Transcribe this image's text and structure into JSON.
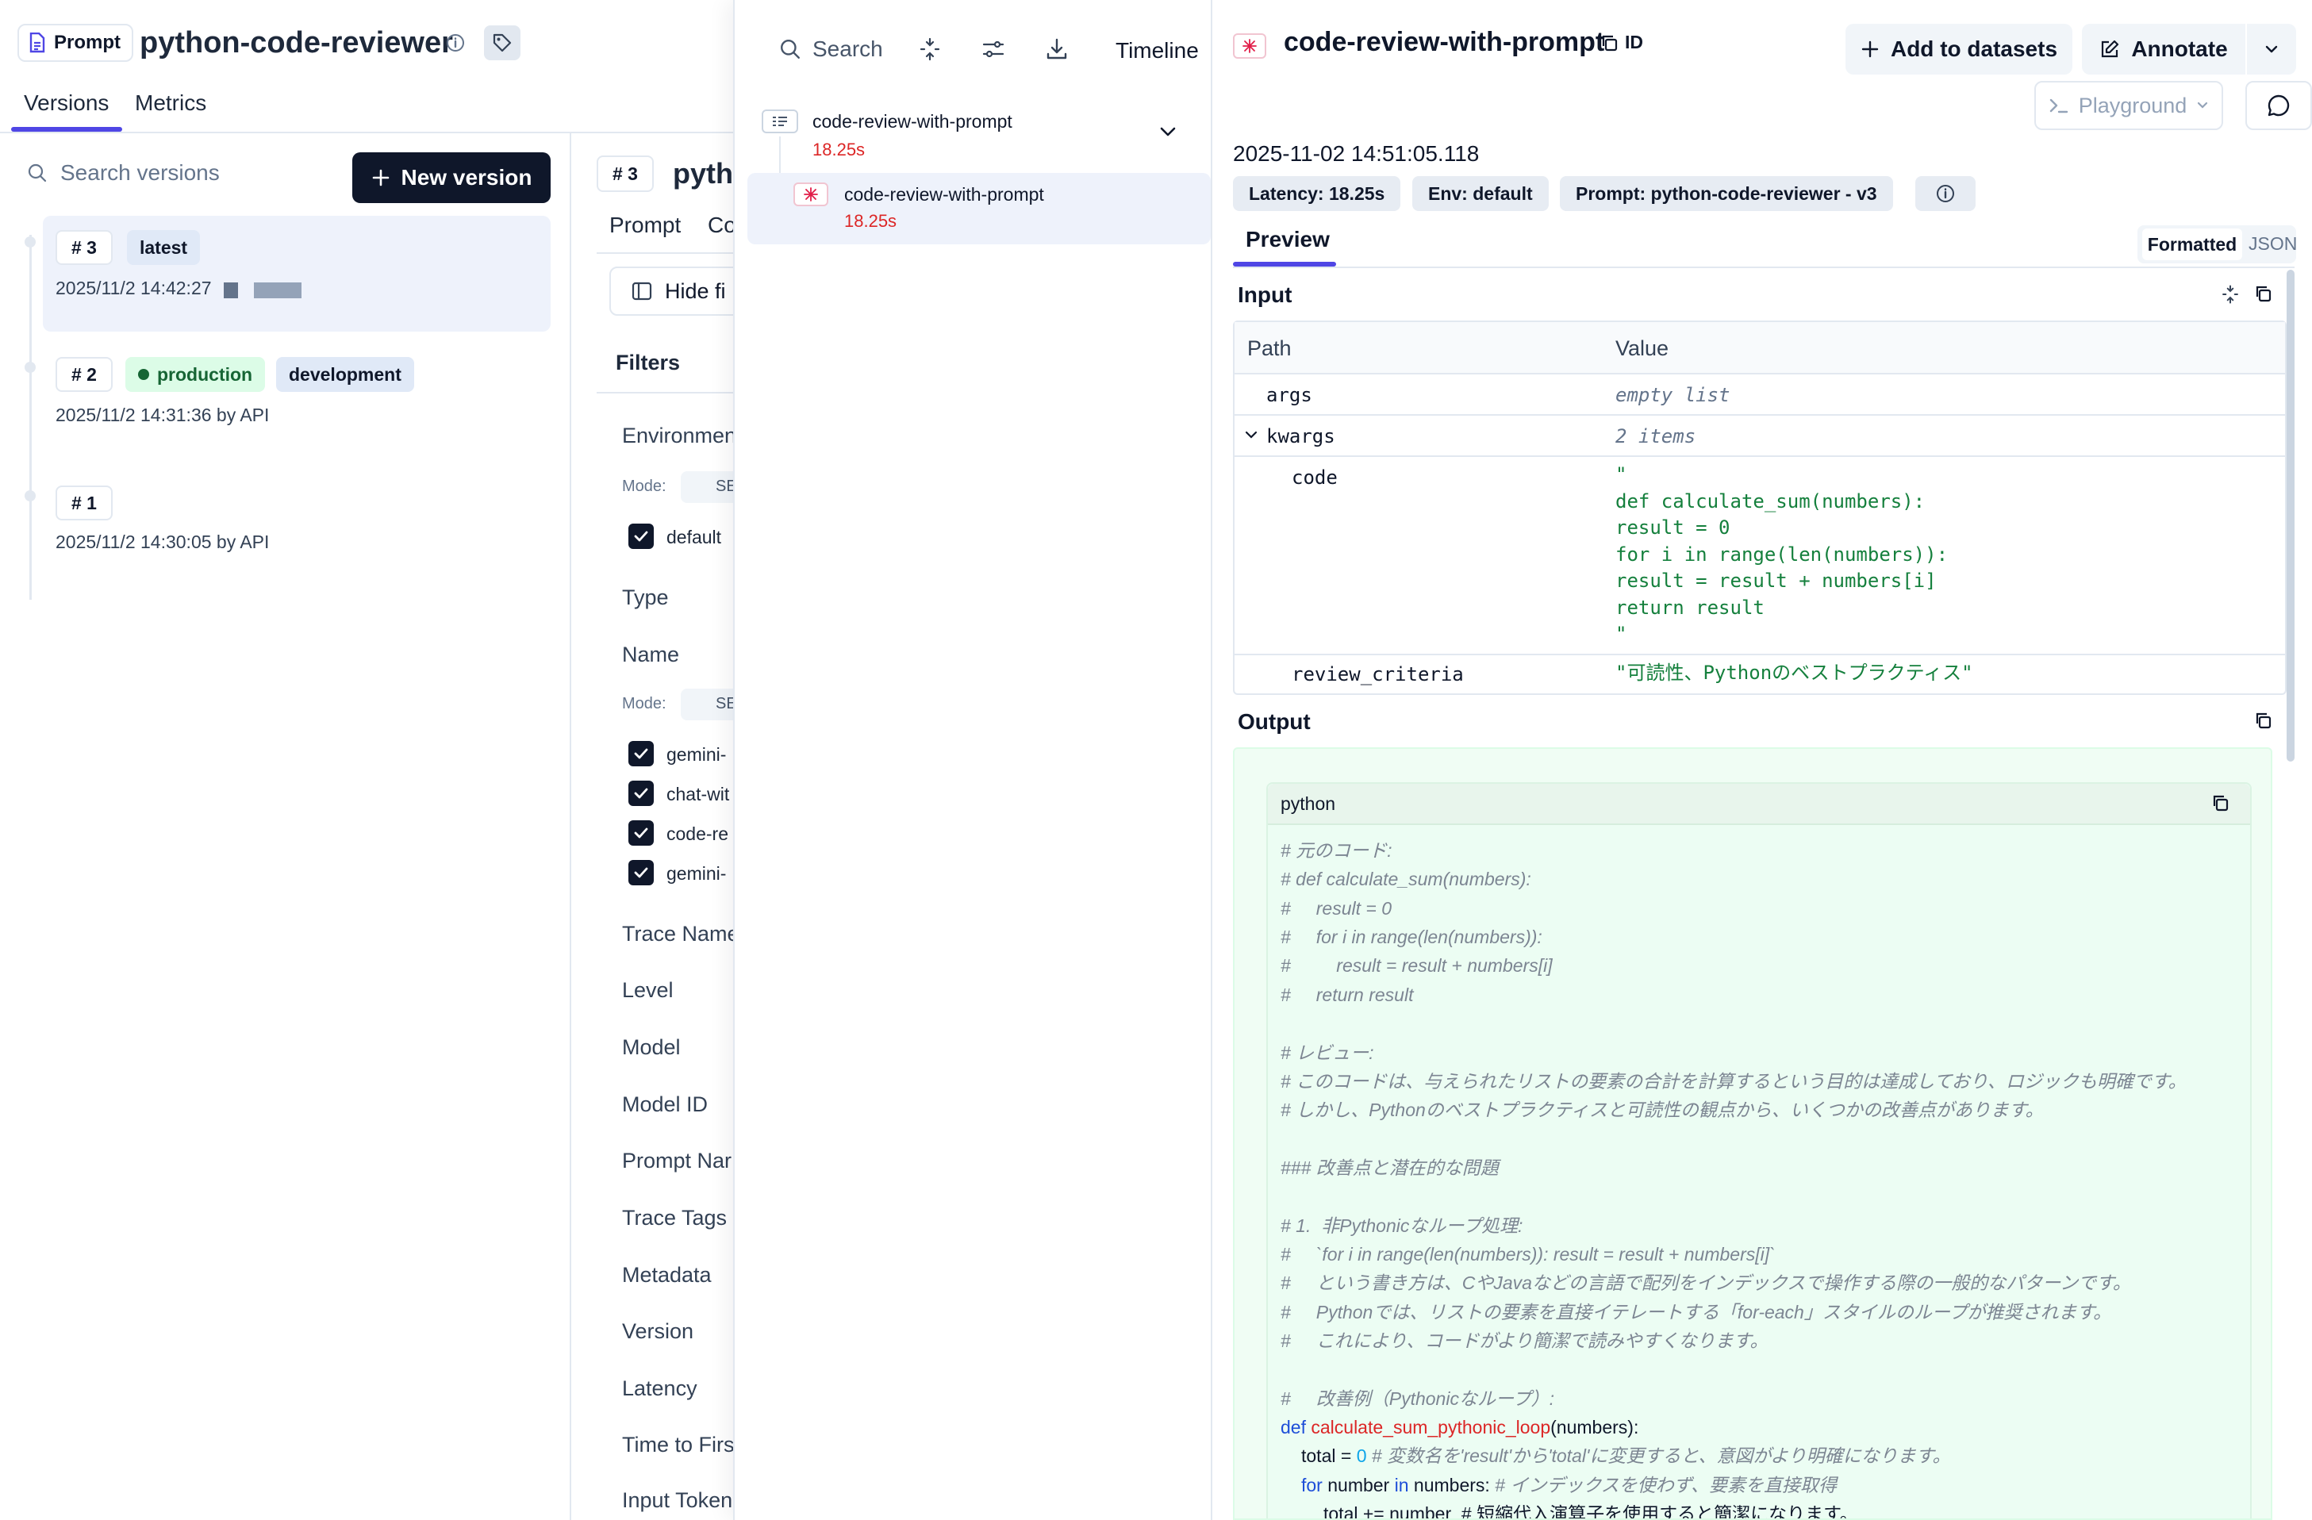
{
  "header": {
    "badge_label": "Prompt",
    "title": "python-code-reviewer"
  },
  "tabs": {
    "versions": "Versions",
    "metrics": "Metrics"
  },
  "versions_panel": {
    "search_placeholder": "Search versions",
    "new_version_label": "New version",
    "versions": [
      {
        "number": "# 3",
        "tags": [
          "latest"
        ],
        "meta": "2025/11/2 14:42:27"
      },
      {
        "number": "# 2",
        "tags": [
          "production",
          "development"
        ],
        "meta": "2025/11/2 14:31:36 by API"
      },
      {
        "number": "# 1",
        "tags": [],
        "meta": "2025/11/2 14:30:05 by API"
      }
    ]
  },
  "detail_peek": {
    "version_number": "# 3",
    "title_fragment": "pytho",
    "tab_prompt": "Prompt",
    "tab_fragment": "Co",
    "hide_filters": "Hide fi",
    "filters_heading": "Filters",
    "environment": "Environmen",
    "mode_label": "Mode:",
    "mode_value": "SE",
    "default_label": "default",
    "type_label": "Type",
    "name_label": "Name",
    "name_options": [
      "gemini-",
      "chat-wit",
      "code-re",
      "gemini-"
    ],
    "filters": [
      "Trace Name",
      "Level",
      "Model",
      "Model ID",
      "Prompt Nar",
      "Trace Tags",
      "Metadata",
      "Version",
      "Latency",
      "Time to Firs",
      "Input Token"
    ]
  },
  "trace_tree": {
    "search_label": "Search",
    "timeline_label": "Timeline",
    "items": [
      {
        "title": "code-review-with-prompt",
        "latency": "18.25s"
      },
      {
        "title": "code-review-with-prompt",
        "latency": "18.25s"
      }
    ]
  },
  "detail": {
    "title": "code-review-with-prompt",
    "id_label": "ID",
    "add_to_datasets": "Add to datasets",
    "annotate": "Annotate",
    "playground": "Playground",
    "timestamp": "2025-11-02 14:51:05.118",
    "chips": {
      "latency": "Latency: 18.25s",
      "env": "Env: default",
      "prompt": "Prompt: python-code-reviewer - v3"
    },
    "preview_tab": "Preview",
    "formatted": "Formatted",
    "json": "JSON",
    "input_label": "Input",
    "output_label": "Output",
    "table": {
      "col_path": "Path",
      "col_value": "Value",
      "rows": [
        {
          "path": "args",
          "value": "empty list"
        },
        {
          "path": "kwargs",
          "value": "2 items"
        },
        {
          "path": "code",
          "value": "\"\ndef calculate_sum(numbers):\nresult = 0\nfor i in range(len(numbers)):\nresult = result + numbers[i]\nreturn result\n\""
        },
        {
          "path": "review_criteria",
          "value": "\"可読性、Pythonのベストプラクティス\""
        }
      ]
    },
    "code_lang": "python",
    "code_lines": [
      "# 元のコード:",
      "# def calculate_sum(numbers):",
      "#     result = 0",
      "#     for i in range(len(numbers)):",
      "#         result = result + numbers[i]",
      "#     return result",
      "",
      "# レビュー:",
      "# このコードは、与えられたリストの要素の合計を計算するという目的は達成しており、ロジックも明確です。",
      "# しかし、Pythonのベストプラクティスと可読性の観点から、いくつかの改善点があります。",
      "",
      "### 改善点と潜在的な問題",
      "",
      "# 1.  非Pythonicなループ処理:",
      "#     `for i in range(len(numbers)): result = result + numbers[i]`",
      "#     という書き方は、CやJavaなどの言語で配列をインデックスで操作する際の一般的なパターンです。",
      "#     Pythonでは、リストの要素を直接イテレートする「for-each」スタイルのループが推奨されます。",
      "#     これにより、コードがより簡潔で読みやすくなります。",
      "",
      "#     改善例（Pythonicなループ）:"
    ],
    "code_def_kw": "def",
    "code_def_fn": "calculate_sum_pythonic_loop",
    "code_def_rest": "(numbers):",
    "code_total": "total = ",
    "code_zero": "0",
    "code_total_comment": "# 変数名を'result'から'total'に変更すると、意図がより明確になります。",
    "code_for_kw": "for",
    "code_for_var": " number ",
    "code_in_kw": "in",
    "code_for_rest": " numbers:",
    "code_for_comment": "# インデックスを使わず、要素を直接取得",
    "code_last_line": "total += number  # 短縮代入演算子を使用すると簡潔になります。"
  }
}
